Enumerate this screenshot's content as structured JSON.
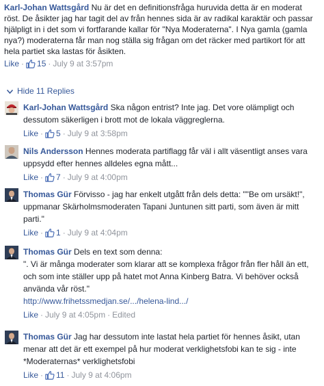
{
  "top_comment": {
    "author": "Karl-Johan Wattsgård",
    "text": "Nu är det en definitionsfråga huruvida detta är en moderat röst. De åsikter jag har tagit del av från hennes sida är av radikal karaktär och passar hjälpligt in i det som vi fortfarande kallar för \"Nya Moderaterna\". I Nya gamla (gamla nya?) moderaterna får man nog ställa sig frågan om det räcker med partikort för att hela partiet ska lastas för åsikten.",
    "like_label": "Like",
    "like_count": "15",
    "timestamp": "July 9 at 3:57pm"
  },
  "toggle": {
    "icon": "caret-down-icon",
    "label": "Hide 11 Replies"
  },
  "replies": [
    {
      "author": "Karl-Johan Wattsgård",
      "avatar": "red-cap-avatar",
      "text": "Ska någon entrist? Inte jag. Det vore olämpligt och dessutom säkerligen i brott mot de lokala väggreglerna.",
      "like_label": "Like",
      "like_count": "5",
      "timestamp": "July 9 at 3:58pm"
    },
    {
      "author": "Nils Andersson",
      "avatar": "portrait-avatar",
      "text": "Hennes moderata partiflagg får väl i allt väsentligt anses vara uppsydd efter hennes alldeles egna mått...",
      "like_label": "Like",
      "like_count": "7",
      "timestamp": "July 9 at 4:00pm"
    },
    {
      "author": "Thomas Gür",
      "avatar": "suit-avatar",
      "text": "Förvisso - jag har enkelt utgått från dels detta: \"\"Be om ursäkt!\", uppmanar Skärholmsmoderaten Tapani Juntunen sitt parti, som även är mitt parti.\"",
      "like_label": "Like",
      "like_count": "1",
      "timestamp": "July 9 at 4:04pm"
    },
    {
      "author": "Thomas Gür",
      "avatar": "suit-avatar",
      "text": "Dels en text som denna:\n\". Vi är många moderater som klarar att se komplexa frågor från fler håll än ett, och som inte ställer upp på hatet mot Anna Kinberg Batra. Vi behöver också använda vår röst.\"",
      "link": "http://www.frihetssmedjan.se/.../helena-lind.../",
      "like_label": "Like",
      "timestamp": "July 9 at 4:05pm",
      "edited": "Edited"
    },
    {
      "author": "Thomas Gür",
      "avatar": "suit-avatar",
      "text": "Jag har dessutom inte lastat hela partiet för hennes åsikt, utan menar att det är ett exempel på hur moderat verklighetsfobi kan te sig - inte *Moderaternas* verklighetsfobi",
      "like_label": "Like",
      "like_count": "11",
      "timestamp": "July 9 at 4:06pm"
    }
  ],
  "colors": {
    "link": "#365899",
    "meta": "#90949c",
    "text": "#1d2129"
  }
}
